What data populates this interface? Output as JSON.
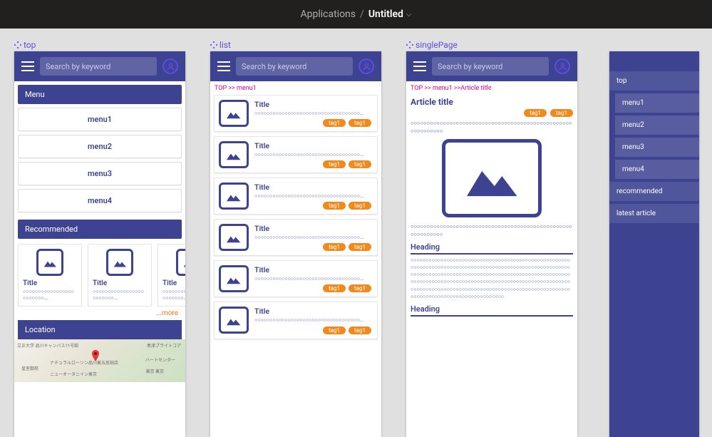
{
  "header": {
    "applications": "Applications",
    "separator": "/",
    "title": "Untitled"
  },
  "artboards": {
    "top": "top",
    "list": "list",
    "single": "singlePage"
  },
  "search_placeholder": "Search by keyword",
  "top": {
    "menu_header": "Menu",
    "menus": [
      "menu1",
      "menu2",
      "menu3",
      "menu4"
    ],
    "recommended_header": "Recommended",
    "rec_title": "Title",
    "rec_desc": "○○○○○○○○○○○○○○○○○○○○○○○○...",
    "more": "...more",
    "location_header": "Location"
  },
  "list": {
    "breadcrumb": "TOP >> menu1",
    "card_title": "Title",
    "card_desc": "○○○○○○○○○○○○○○○○○○○○○○○○○○○○○○○○○○○...",
    "tag": "tag1"
  },
  "single": {
    "breadcrumb": "TOP >> menu1 >>Article title",
    "title": "Article title",
    "tag": "tag1",
    "summary": "○○○○○○○○○○○○○○○○○○○○○○○○○○○○○○○○○○○○○○○○○○○○○○○○○○○○○○○○○○○○",
    "heading": "Heading",
    "body": "○○○○○○○○○○○○○○○○○○○○○○○○○○○○○○○○○○○○○○○○○○○○○○○○○○○○○○○○○○○○○○○○○○○○○○○○○○○○○○○○○○○○○○○○○○○○○○○○○○○○○○○○○○○○○○○○○○○○○○○○○○○○○○○○○○○○○○○○○○○○○○○○○○○○○○○○○○○○○○○○○○○○○○○○○○○○○○○○○○○○○○○○○○○○○○○○○○○○○○○○○○○○○○○○○○○○○○○○○○○○○○○○○○○○○○○○○○○○○○○○○○○○○○○○○○○○○○○○○○○○○○○○○○○○○○○○○○○○○○○○○○○○○○○○○○○○○○○○"
  },
  "nav": {
    "items": [
      "top",
      "menu1",
      "menu2",
      "menu3",
      "menu4",
      "recommended",
      "latest article"
    ]
  },
  "map": {
    "label1": "立正大学 品川キャンパス11号館",
    "label2": "ナチュラルローソン品川東五反田店",
    "label3": "ニューオータニイン東京",
    "label4": "島津プライトコア",
    "label5": "ハートセンター",
    "label6": "東京 東京",
    "label7": "皇室御苑"
  }
}
